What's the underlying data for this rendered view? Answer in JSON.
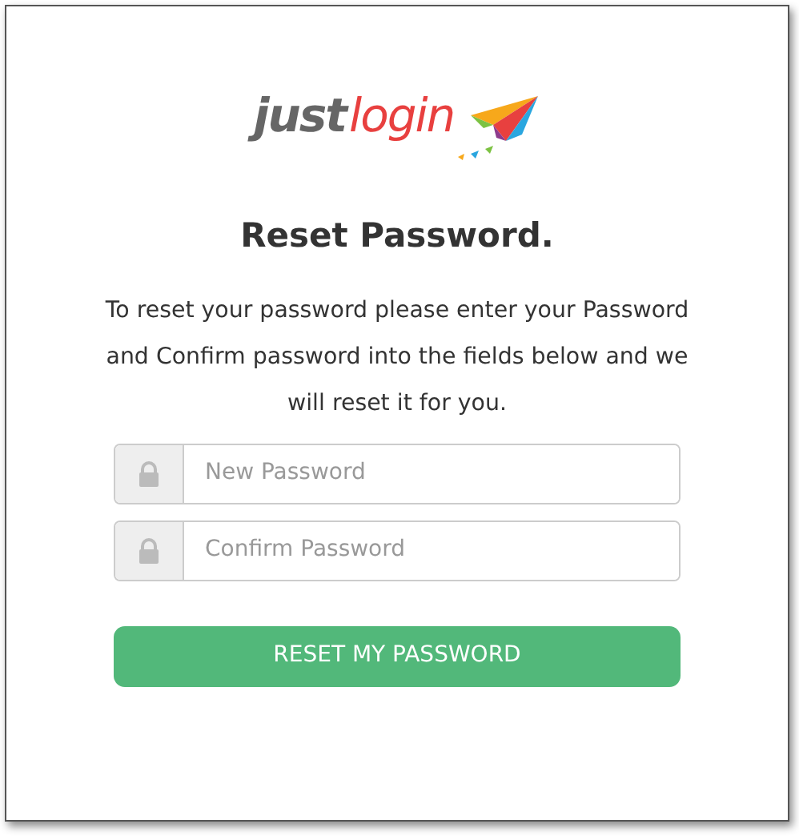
{
  "logo": {
    "part_1": "just",
    "part_2": "login"
  },
  "title": "Reset Password.",
  "instructions": "To reset your password please enter your Password and Confirm password into the fields below and we will reset it for you.",
  "fields": [
    {
      "placeholder": "New Password"
    },
    {
      "placeholder": "Confirm Password"
    }
  ],
  "submit_button": "RESET MY PASSWORD"
}
